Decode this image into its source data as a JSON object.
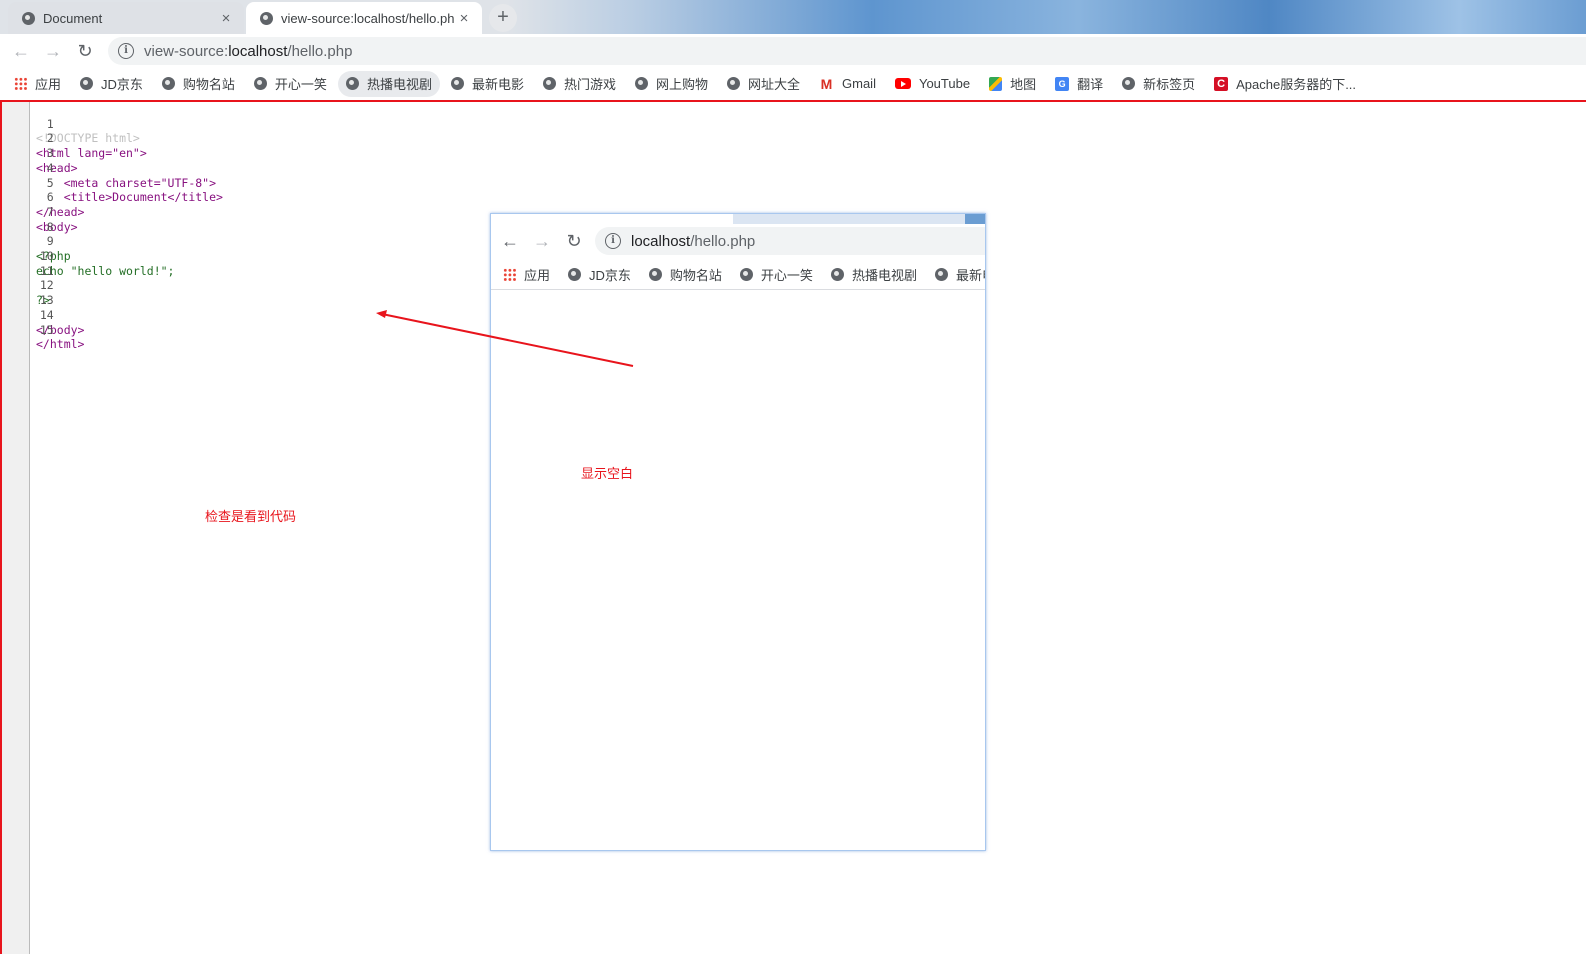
{
  "browser": {
    "tabs": [
      {
        "title": "Document",
        "active": false
      },
      {
        "title": "view-source:localhost/hello.ph",
        "active": true
      }
    ],
    "new_tab_label": "+",
    "close_glyph": "×",
    "url_scheme": "view-source:",
    "url_host": "localhost",
    "url_path": "/hello.php",
    "bookmarks": [
      {
        "label": "应用",
        "icon": "apps-grid-icon"
      },
      {
        "label": "JD京东",
        "icon": "globe-icon"
      },
      {
        "label": "购物名站",
        "icon": "globe-icon"
      },
      {
        "label": "开心一笑",
        "icon": "globe-icon"
      },
      {
        "label": "热播电视剧",
        "icon": "globe-icon"
      },
      {
        "label": "最新电影",
        "icon": "globe-icon"
      },
      {
        "label": "热门游戏",
        "icon": "globe-icon"
      },
      {
        "label": "网上购物",
        "icon": "globe-icon"
      },
      {
        "label": "网址大全",
        "icon": "globe-icon"
      },
      {
        "label": "Gmail",
        "icon": "gmail-icon"
      },
      {
        "label": "YouTube",
        "icon": "youtube-icon"
      },
      {
        "label": "地图",
        "icon": "maps-icon"
      },
      {
        "label": "翻译",
        "icon": "translate-icon"
      },
      {
        "label": "新标签页",
        "icon": "globe-icon"
      },
      {
        "label": "Apache服务器的下...",
        "icon": "apache-icon"
      }
    ]
  },
  "source_lines": [
    {
      "n": "1",
      "text": "<!DOCTYPE html>"
    },
    {
      "n": "2",
      "text": "<html lang=\"en\">"
    },
    {
      "n": "3",
      "text": "<head>"
    },
    {
      "n": "4",
      "text": "    <meta charset=\"UTF-8\">"
    },
    {
      "n": "5",
      "text": "    <title>Document</title>"
    },
    {
      "n": "6",
      "text": "</head>"
    },
    {
      "n": "7",
      "text": "<body>"
    },
    {
      "n": "8",
      "text": ""
    },
    {
      "n": "9",
      "text": "<?php"
    },
    {
      "n": "10",
      "text": "echo \"hello world!\";"
    },
    {
      "n": "11",
      "text": ""
    },
    {
      "n": "12",
      "text": "?>"
    },
    {
      "n": "13",
      "text": ""
    },
    {
      "n": "14",
      "text": "</body>"
    },
    {
      "n": "15",
      "text": "</html>"
    }
  ],
  "annotations": {
    "blank_display": "显示空白",
    "inspect_code": "检查是看到代码"
  },
  "mini_browser": {
    "url_host": "localhost",
    "url_path": "/hello.php",
    "bookmarks": [
      "应用",
      "JD京东",
      "购物名站",
      "开心一笑",
      "热播电视剧",
      "最新电影"
    ]
  },
  "colors": {
    "annotation_red": "#e8141c",
    "tag": "#881280",
    "attr": "#994500",
    "value": "#1a1aa6",
    "php": "#236e25"
  }
}
